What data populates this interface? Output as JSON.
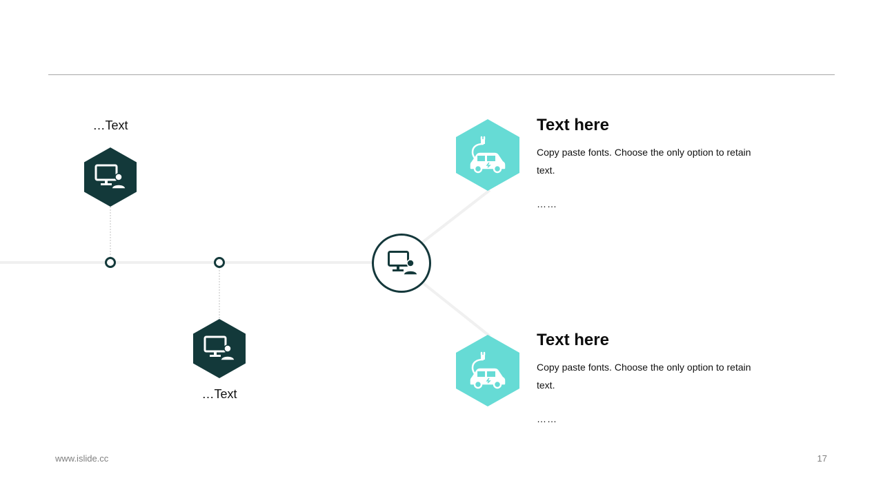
{
  "colors": {
    "dark_teal": "#13393a",
    "aqua": "#66dbd5",
    "line_gray": "#f0f0f0",
    "dashed_gray": "#bfbfbf"
  },
  "left_nodes": [
    {
      "label": "…Text",
      "icon": "monitor-user-icon"
    },
    {
      "label": "…Text",
      "icon": "monitor-user-icon"
    }
  ],
  "center": {
    "icon": "monitor-user-icon"
  },
  "panels": [
    {
      "title": "Text here",
      "body": "Copy paste fonts. Choose the only option to retain text.",
      "dots": "……",
      "icon": "electric-car-icon"
    },
    {
      "title": "Text here",
      "body": "Copy paste fonts. Choose the only option to retain text.",
      "dots": "……",
      "icon": "electric-car-icon"
    }
  ],
  "footer": {
    "website": "www.islide.cc",
    "page_number": "17"
  }
}
